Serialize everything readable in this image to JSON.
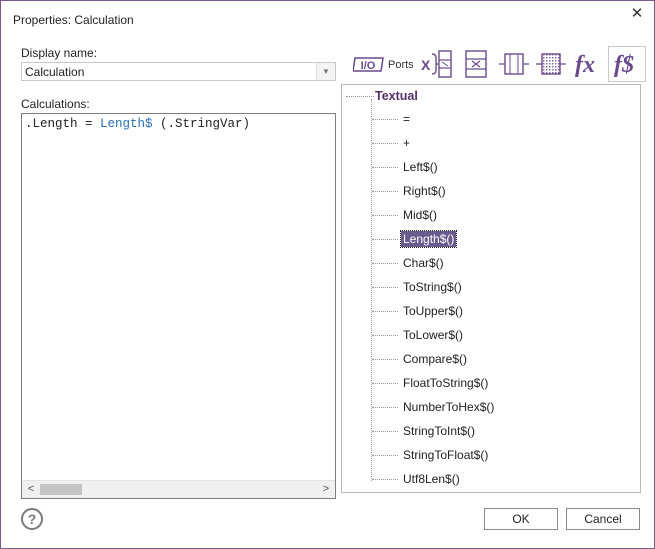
{
  "window": {
    "title": "Properties: Calculation",
    "close_glyph": "✕"
  },
  "display_name": {
    "label": "Display name:",
    "value": "Calculation"
  },
  "calculations": {
    "label": "Calculations:",
    "code_var": ".Length = ",
    "code_fn": "Length$",
    "code_args": " (.StringVar)"
  },
  "toolbar": {
    "io_label": "I/O",
    "ports_label": "Ports",
    "x_glyph": "X",
    "fx_label": "fx",
    "fs_label": "f$"
  },
  "tree": {
    "root": "Textual",
    "items": [
      "=",
      "+",
      "Left$()",
      "Right$()",
      "Mid$()",
      "Length$()",
      "Char$()",
      "ToString$()",
      "ToUpper$()",
      "ToLower$()",
      "Compare$()",
      "FloatToString$()",
      "NumberToHex$()",
      "StringToInt$()",
      "StringToFloat$()",
      "Utf8Len$()"
    ],
    "selected": "Length$()"
  },
  "buttons": {
    "ok": "OK",
    "cancel": "Cancel",
    "help_glyph": "?"
  },
  "colors": {
    "accent": "#6a4a8c",
    "selection": "#6a5b8f",
    "function_text": "#2a6fb5"
  }
}
